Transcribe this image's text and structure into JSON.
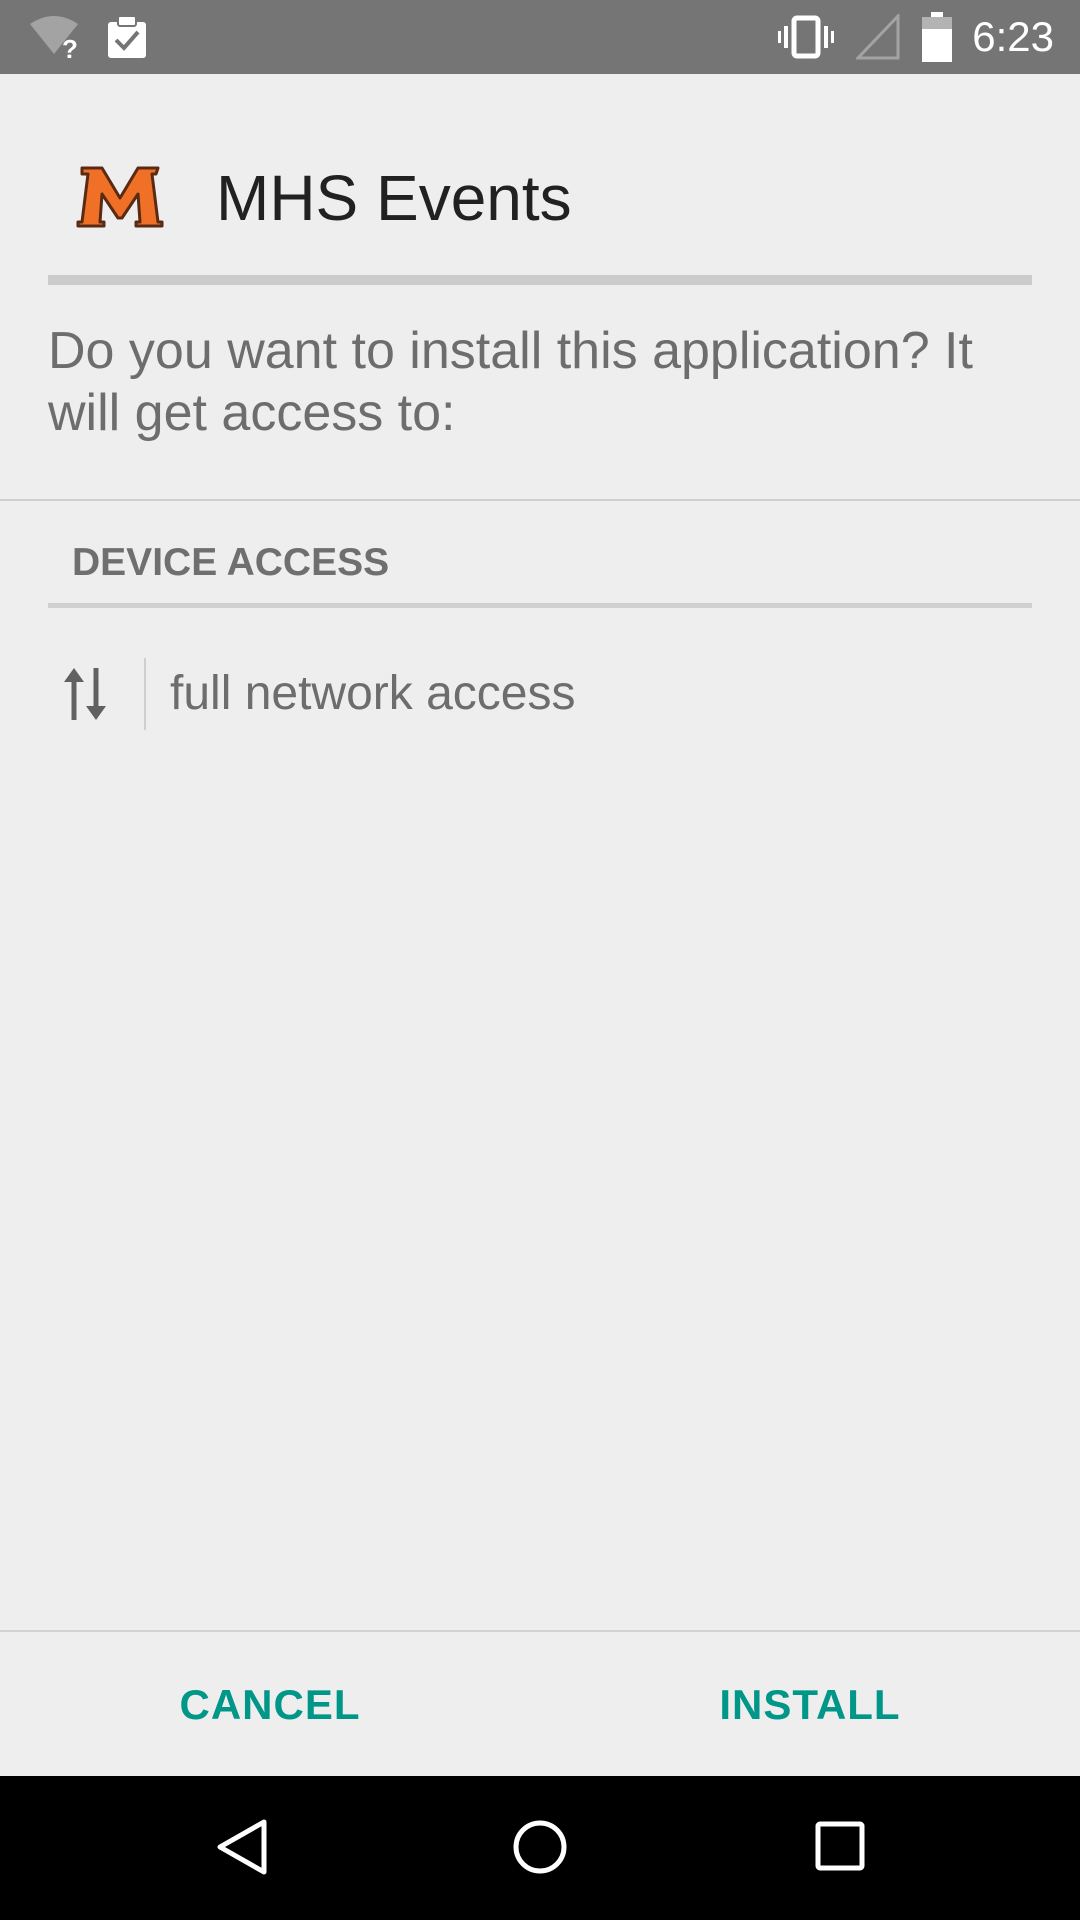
{
  "status_bar": {
    "time": "6:23",
    "icons": [
      "wifi-question-icon",
      "clipboard-check-icon",
      "vibrate-icon",
      "signal-empty-icon",
      "battery-icon"
    ]
  },
  "header": {
    "app_logo_icon": "mhs-m-logo-icon",
    "app_title": "MHS Events"
  },
  "prompt": "Do you want to install this application? It will get access to:",
  "section": {
    "title": "DEVICE ACCESS",
    "permissions": [
      {
        "icon": "network-arrows-icon",
        "label": "full network access"
      }
    ]
  },
  "buttons": {
    "cancel": "CANCEL",
    "install": "INSTALL"
  },
  "nav_bar": {
    "icons": [
      "back-icon",
      "home-icon",
      "recents-icon"
    ]
  },
  "colors": {
    "accent": "#009688",
    "logo_orange": "#f07027",
    "status_bar": "#757575"
  }
}
